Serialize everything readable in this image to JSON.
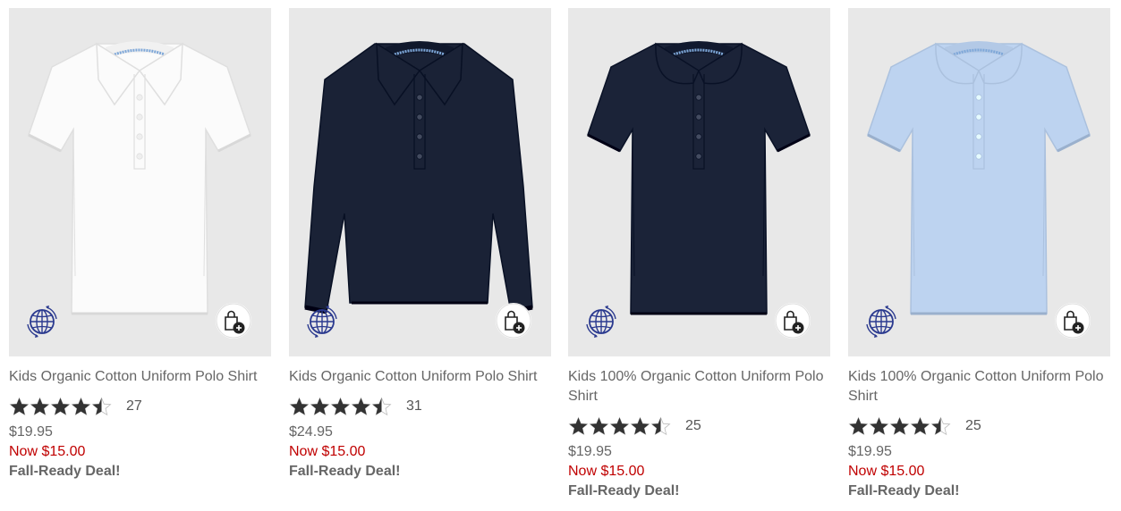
{
  "colors": {
    "image_bg": "#e8e8e8",
    "sale_red": "#c00000",
    "text_gray": "#666666",
    "star": "#333333",
    "globe_blue": "#2b3a8f"
  },
  "products": [
    {
      "title": "Kids Organic Cotton Uniform Polo Shirt",
      "rating": 4.5,
      "review_count": "27",
      "original_price": "$19.95",
      "sale_price": "Now $15.00",
      "promo": "Fall-Ready Deal!",
      "shirt_color": "#fbfbfb",
      "sleeve": "short",
      "collar": "pointed",
      "icons": [
        "organic-globe-icon",
        "add-to-bag-icon"
      ]
    },
    {
      "title": "Kids Organic Cotton Uniform Polo Shirt",
      "rating": 4.5,
      "review_count": "31",
      "original_price": "$24.95",
      "sale_price": "Now $15.00",
      "promo": "Fall-Ready Deal!",
      "shirt_color": "#1a2236",
      "sleeve": "long",
      "collar": "pointed",
      "icons": [
        "organic-globe-icon",
        "add-to-bag-icon"
      ]
    },
    {
      "title": "Kids 100% Organic Cotton Uniform Polo Shirt",
      "rating": 4.5,
      "review_count": "25",
      "original_price": "$19.95",
      "sale_price": "Now $15.00",
      "promo": "Fall-Ready Deal!",
      "shirt_color": "#1b2338",
      "sleeve": "short",
      "collar": "rounded",
      "icons": [
        "organic-globe-icon",
        "add-to-bag-icon"
      ]
    },
    {
      "title": "Kids 100% Organic Cotton Uniform Polo Shirt",
      "rating": 4.5,
      "review_count": "25",
      "original_price": "$19.95",
      "sale_price": "Now $15.00",
      "promo": "Fall-Ready Deal!",
      "shirt_color": "#bdd3f0",
      "sleeve": "short",
      "collar": "rounded",
      "icons": [
        "organic-globe-icon",
        "add-to-bag-icon"
      ]
    }
  ]
}
